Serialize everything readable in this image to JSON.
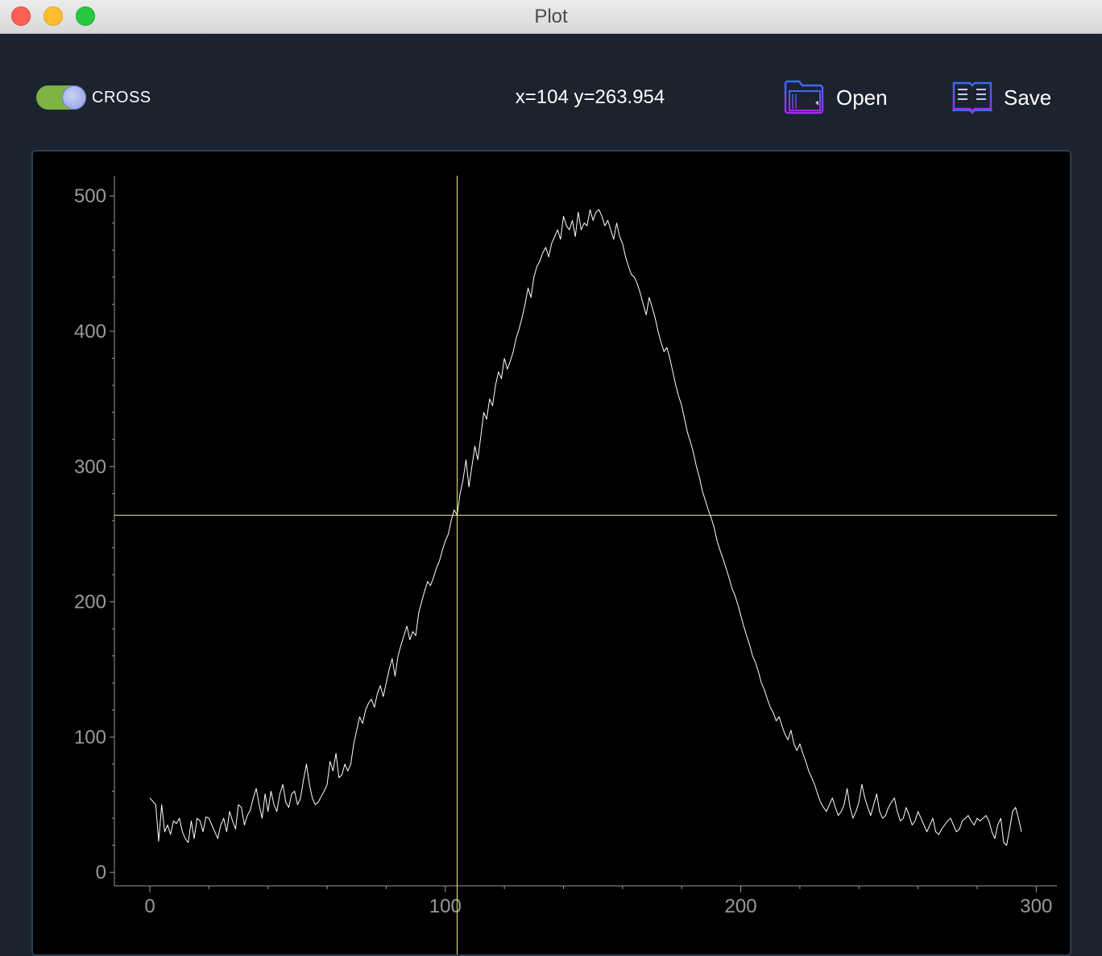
{
  "window": {
    "title": "Plot"
  },
  "toolbar": {
    "toggle": {
      "label": "CROSS",
      "on": true
    },
    "coords_text": "x=104 y=263.954",
    "open_label": "Open",
    "save_label": "Save",
    "open_icon": "folder-icon",
    "save_icon": "book-icon"
  },
  "colors": {
    "background": "#1a232e",
    "plot_background": "#000000",
    "line": "#ffffff",
    "crosshair": "#f0f07a",
    "axis": "#9a9a9a",
    "toggle_on": "#7cb342",
    "icon_accent": "#7b2ff7"
  },
  "chart_data": {
    "type": "line",
    "title": "",
    "xlabel": "",
    "ylabel": "",
    "xlim": [
      -12,
      307
    ],
    "ylim": [
      -10,
      515
    ],
    "x_ticks": [
      0,
      100,
      200,
      300
    ],
    "y_ticks": [
      0,
      100,
      200,
      300,
      400,
      500
    ],
    "grid": false,
    "crosshair": {
      "x": 104,
      "y": 263.954
    },
    "series": [
      {
        "points": [
          [
            0,
            55
          ],
          [
            2,
            50
          ],
          [
            3,
            23
          ],
          [
            4,
            50
          ],
          [
            5,
            30
          ],
          [
            6,
            35
          ],
          [
            7,
            28
          ],
          [
            8,
            38
          ],
          [
            9,
            36
          ],
          [
            10,
            40
          ],
          [
            11,
            30
          ],
          [
            12,
            25
          ],
          [
            13,
            22
          ],
          [
            14,
            38
          ],
          [
            15,
            25
          ],
          [
            16,
            40
          ],
          [
            17,
            38
          ],
          [
            18,
            30
          ],
          [
            19,
            41
          ],
          [
            20,
            40
          ],
          [
            21,
            35
          ],
          [
            22,
            30
          ],
          [
            23,
            25
          ],
          [
            24,
            35
          ],
          [
            25,
            40
          ],
          [
            26,
            30
          ],
          [
            27,
            45
          ],
          [
            28,
            38
          ],
          [
            29,
            32
          ],
          [
            30,
            50
          ],
          [
            31,
            48
          ],
          [
            32,
            35
          ],
          [
            33,
            42
          ],
          [
            34,
            46
          ],
          [
            35,
            55
          ],
          [
            36,
            62
          ],
          [
            37,
            50
          ],
          [
            38,
            40
          ],
          [
            39,
            58
          ],
          [
            40,
            45
          ],
          [
            41,
            60
          ],
          [
            42,
            50
          ],
          [
            43,
            45
          ],
          [
            44,
            58
          ],
          [
            45,
            65
          ],
          [
            46,
            52
          ],
          [
            47,
            48
          ],
          [
            48,
            58
          ],
          [
            49,
            60
          ],
          [
            50,
            50
          ],
          [
            51,
            55
          ],
          [
            52,
            68
          ],
          [
            53,
            80
          ],
          [
            54,
            65
          ],
          [
            55,
            55
          ],
          [
            56,
            50
          ],
          [
            57,
            52
          ],
          [
            58,
            56
          ],
          [
            59,
            60
          ],
          [
            60,
            65
          ],
          [
            61,
            82
          ],
          [
            62,
            75
          ],
          [
            63,
            88
          ],
          [
            64,
            70
          ],
          [
            65,
            72
          ],
          [
            66,
            80
          ],
          [
            67,
            75
          ],
          [
            68,
            80
          ],
          [
            69,
            95
          ],
          [
            70,
            105
          ],
          [
            71,
            115
          ],
          [
            72,
            110
          ],
          [
            73,
            120
          ],
          [
            74,
            125
          ],
          [
            75,
            128
          ],
          [
            76,
            122
          ],
          [
            77,
            132
          ],
          [
            78,
            138
          ],
          [
            79,
            130
          ],
          [
            80,
            140
          ],
          [
            81,
            150
          ],
          [
            82,
            158
          ],
          [
            83,
            145
          ],
          [
            84,
            160
          ],
          [
            85,
            168
          ],
          [
            86,
            175
          ],
          [
            87,
            182
          ],
          [
            88,
            172
          ],
          [
            89,
            178
          ],
          [
            90,
            175
          ],
          [
            91,
            192
          ],
          [
            92,
            200
          ],
          [
            93,
            208
          ],
          [
            94,
            215
          ],
          [
            95,
            212
          ],
          [
            96,
            218
          ],
          [
            97,
            225
          ],
          [
            98,
            230
          ],
          [
            99,
            238
          ],
          [
            100,
            245
          ],
          [
            101,
            250
          ],
          [
            102,
            260
          ],
          [
            103,
            268
          ],
          [
            104,
            264
          ],
          [
            105,
            280
          ],
          [
            106,
            290
          ],
          [
            107,
            305
          ],
          [
            108,
            285
          ],
          [
            109,
            300
          ],
          [
            110,
            315
          ],
          [
            111,
            305
          ],
          [
            112,
            322
          ],
          [
            113,
            340
          ],
          [
            114,
            335
          ],
          [
            115,
            350
          ],
          [
            116,
            345
          ],
          [
            117,
            360
          ],
          [
            118,
            370
          ],
          [
            119,
            365
          ],
          [
            120,
            380
          ],
          [
            121,
            372
          ],
          [
            122,
            378
          ],
          [
            123,
            385
          ],
          [
            124,
            395
          ],
          [
            125,
            402
          ],
          [
            126,
            410
          ],
          [
            127,
            420
          ],
          [
            128,
            432
          ],
          [
            129,
            425
          ],
          [
            130,
            440
          ],
          [
            131,
            448
          ],
          [
            132,
            452
          ],
          [
            133,
            458
          ],
          [
            134,
            462
          ],
          [
            135,
            455
          ],
          [
            136,
            465
          ],
          [
            137,
            470
          ],
          [
            138,
            475
          ],
          [
            139,
            468
          ],
          [
            140,
            485
          ],
          [
            141,
            478
          ],
          [
            142,
            475
          ],
          [
            143,
            482
          ],
          [
            144,
            470
          ],
          [
            145,
            488
          ],
          [
            146,
            475
          ],
          [
            147,
            480
          ],
          [
            148,
            478
          ],
          [
            149,
            490
          ],
          [
            150,
            482
          ],
          [
            151,
            488
          ],
          [
            152,
            490
          ],
          [
            153,
            485
          ],
          [
            154,
            478
          ],
          [
            155,
            482
          ],
          [
            156,
            475
          ],
          [
            157,
            468
          ],
          [
            158,
            480
          ],
          [
            159,
            470
          ],
          [
            160,
            465
          ],
          [
            161,
            455
          ],
          [
            162,
            448
          ],
          [
            163,
            442
          ],
          [
            164,
            440
          ],
          [
            165,
            435
          ],
          [
            166,
            428
          ],
          [
            167,
            420
          ],
          [
            168,
            412
          ],
          [
            169,
            425
          ],
          [
            170,
            418
          ],
          [
            171,
            410
          ],
          [
            172,
            400
          ],
          [
            173,
            392
          ],
          [
            174,
            385
          ],
          [
            175,
            388
          ],
          [
            176,
            380
          ],
          [
            177,
            370
          ],
          [
            178,
            360
          ],
          [
            179,
            352
          ],
          [
            180,
            345
          ],
          [
            181,
            335
          ],
          [
            182,
            325
          ],
          [
            183,
            318
          ],
          [
            184,
            310
          ],
          [
            185,
            300
          ],
          [
            186,
            292
          ],
          [
            187,
            282
          ],
          [
            188,
            275
          ],
          [
            189,
            268
          ],
          [
            190,
            262
          ],
          [
            191,
            255
          ],
          [
            192,
            245
          ],
          [
            193,
            238
          ],
          [
            194,
            232
          ],
          [
            195,
            225
          ],
          [
            196,
            218
          ],
          [
            197,
            210
          ],
          [
            198,
            205
          ],
          [
            199,
            198
          ],
          [
            200,
            190
          ],
          [
            201,
            182
          ],
          [
            202,
            175
          ],
          [
            203,
            168
          ],
          [
            204,
            160
          ],
          [
            205,
            155
          ],
          [
            206,
            148
          ],
          [
            207,
            140
          ],
          [
            208,
            135
          ],
          [
            209,
            128
          ],
          [
            210,
            122
          ],
          [
            211,
            118
          ],
          [
            212,
            112
          ],
          [
            213,
            115
          ],
          [
            214,
            108
          ],
          [
            215,
            102
          ],
          [
            216,
            98
          ],
          [
            217,
            105
          ],
          [
            218,
            95
          ],
          [
            219,
            90
          ],
          [
            220,
            95
          ],
          [
            221,
            88
          ],
          [
            222,
            82
          ],
          [
            223,
            75
          ],
          [
            224,
            70
          ],
          [
            225,
            65
          ],
          [
            226,
            58
          ],
          [
            227,
            52
          ],
          [
            228,
            48
          ],
          [
            229,
            45
          ],
          [
            230,
            50
          ],
          [
            231,
            55
          ],
          [
            232,
            48
          ],
          [
            233,
            42
          ],
          [
            234,
            45
          ],
          [
            235,
            50
          ],
          [
            236,
            62
          ],
          [
            237,
            48
          ],
          [
            238,
            40
          ],
          [
            239,
            45
          ],
          [
            240,
            52
          ],
          [
            241,
            65
          ],
          [
            242,
            55
          ],
          [
            243,
            48
          ],
          [
            244,
            42
          ],
          [
            245,
            50
          ],
          [
            246,
            58
          ],
          [
            247,
            45
          ],
          [
            248,
            40
          ],
          [
            249,
            42
          ],
          [
            250,
            48
          ],
          [
            251,
            52
          ],
          [
            252,
            55
          ],
          [
            253,
            45
          ],
          [
            254,
            38
          ],
          [
            255,
            40
          ],
          [
            256,
            48
          ],
          [
            257,
            42
          ],
          [
            258,
            35
          ],
          [
            259,
            38
          ],
          [
            260,
            45
          ],
          [
            261,
            40
          ],
          [
            262,
            35
          ],
          [
            263,
            30
          ],
          [
            264,
            35
          ],
          [
            265,
            40
          ],
          [
            266,
            30
          ],
          [
            267,
            28
          ],
          [
            268,
            32
          ],
          [
            269,
            35
          ],
          [
            270,
            38
          ],
          [
            271,
            40
          ],
          [
            272,
            35
          ],
          [
            273,
            30
          ],
          [
            274,
            32
          ],
          [
            275,
            38
          ],
          [
            276,
            40
          ],
          [
            277,
            42
          ],
          [
            278,
            38
          ],
          [
            279,
            35
          ],
          [
            280,
            40
          ],
          [
            281,
            38
          ],
          [
            282,
            40
          ],
          [
            283,
            42
          ],
          [
            284,
            38
          ],
          [
            285,
            30
          ],
          [
            286,
            25
          ],
          [
            287,
            35
          ],
          [
            288,
            40
          ],
          [
            289,
            22
          ],
          [
            290,
            20
          ],
          [
            291,
            32
          ],
          [
            292,
            45
          ],
          [
            293,
            48
          ],
          [
            294,
            40
          ],
          [
            295,
            30
          ]
        ]
      }
    ]
  }
}
